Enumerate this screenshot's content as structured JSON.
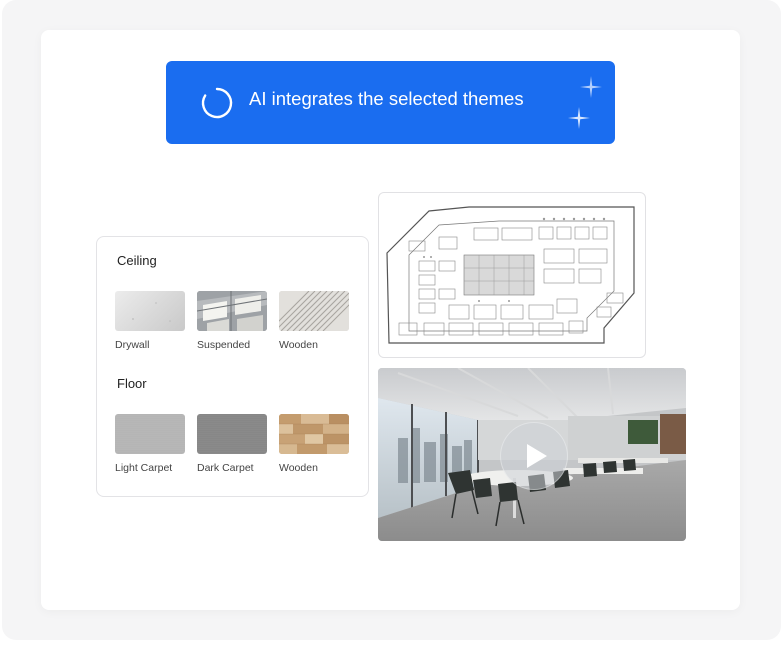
{
  "banner": {
    "text": "AI integrates the selected themes",
    "color": "#1a6df0"
  },
  "materials": {
    "ceiling": {
      "title": "Ceiling",
      "items": [
        {
          "label": "Drywall"
        },
        {
          "label": "Suspended"
        },
        {
          "label": "Wooden"
        }
      ]
    },
    "floor": {
      "title": "Floor",
      "items": [
        {
          "label": "Light Carpet"
        },
        {
          "label": "Dark Carpet"
        },
        {
          "label": "Wooden"
        }
      ]
    }
  },
  "preview": {
    "floor_plan_icon": "office-floor-plan",
    "render_icon": "office-interior-render",
    "play_icon": "play-icon"
  }
}
